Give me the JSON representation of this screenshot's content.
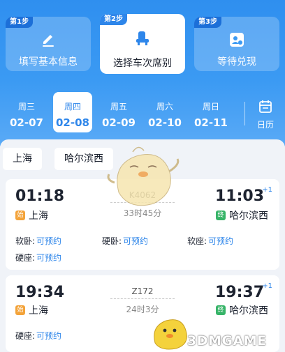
{
  "steps": [
    {
      "tag": "第1步",
      "label": "填写基本信息",
      "icon": "pencil-icon"
    },
    {
      "tag": "第2步",
      "label": "选择车次席别",
      "icon": "seat-icon"
    },
    {
      "tag": "第3步",
      "label": "等待兑现",
      "icon": "ticket-icon"
    }
  ],
  "dates": [
    {
      "weekday": "周三",
      "date": "02-07"
    },
    {
      "weekday": "周四",
      "date": "02-08"
    },
    {
      "weekday": "周五",
      "date": "02-09"
    },
    {
      "weekday": "周六",
      "date": "02-10"
    },
    {
      "weekday": "周日",
      "date": "02-11"
    }
  ],
  "calendar_label": "日历",
  "route": {
    "from": "上海",
    "to": "哈尔滨西"
  },
  "trains": [
    {
      "dep_time": "01:18",
      "arr_time": "11:03",
      "arr_plus": "+1",
      "train_no": "K4062",
      "duration": "33时45分",
      "dep_badge": "始",
      "dep_station": "上海",
      "arr_badge": "终",
      "arr_station": "哈尔滨西",
      "seats": [
        {
          "type": "软卧:",
          "status": "可预约"
        },
        {
          "type": "硬卧:",
          "status": "可预约"
        },
        {
          "type": "软座:",
          "status": "可预约"
        },
        {
          "type": "硬座:",
          "status": "可预约"
        }
      ]
    },
    {
      "dep_time": "19:34",
      "arr_time": "19:37",
      "arr_plus": "+1",
      "train_no": "Z172",
      "duration": "24时3分",
      "dep_badge": "始",
      "dep_station": "上海",
      "arr_badge": "终",
      "arr_station": "哈尔滨西",
      "seats": [
        {
          "type": "硬座:",
          "status": "可预约"
        }
      ]
    }
  ],
  "watermark": "3DMGAME",
  "colors": {
    "accent": "#2e86ea",
    "start_badge": "#f3a33a",
    "end_badge": "#37b468"
  }
}
